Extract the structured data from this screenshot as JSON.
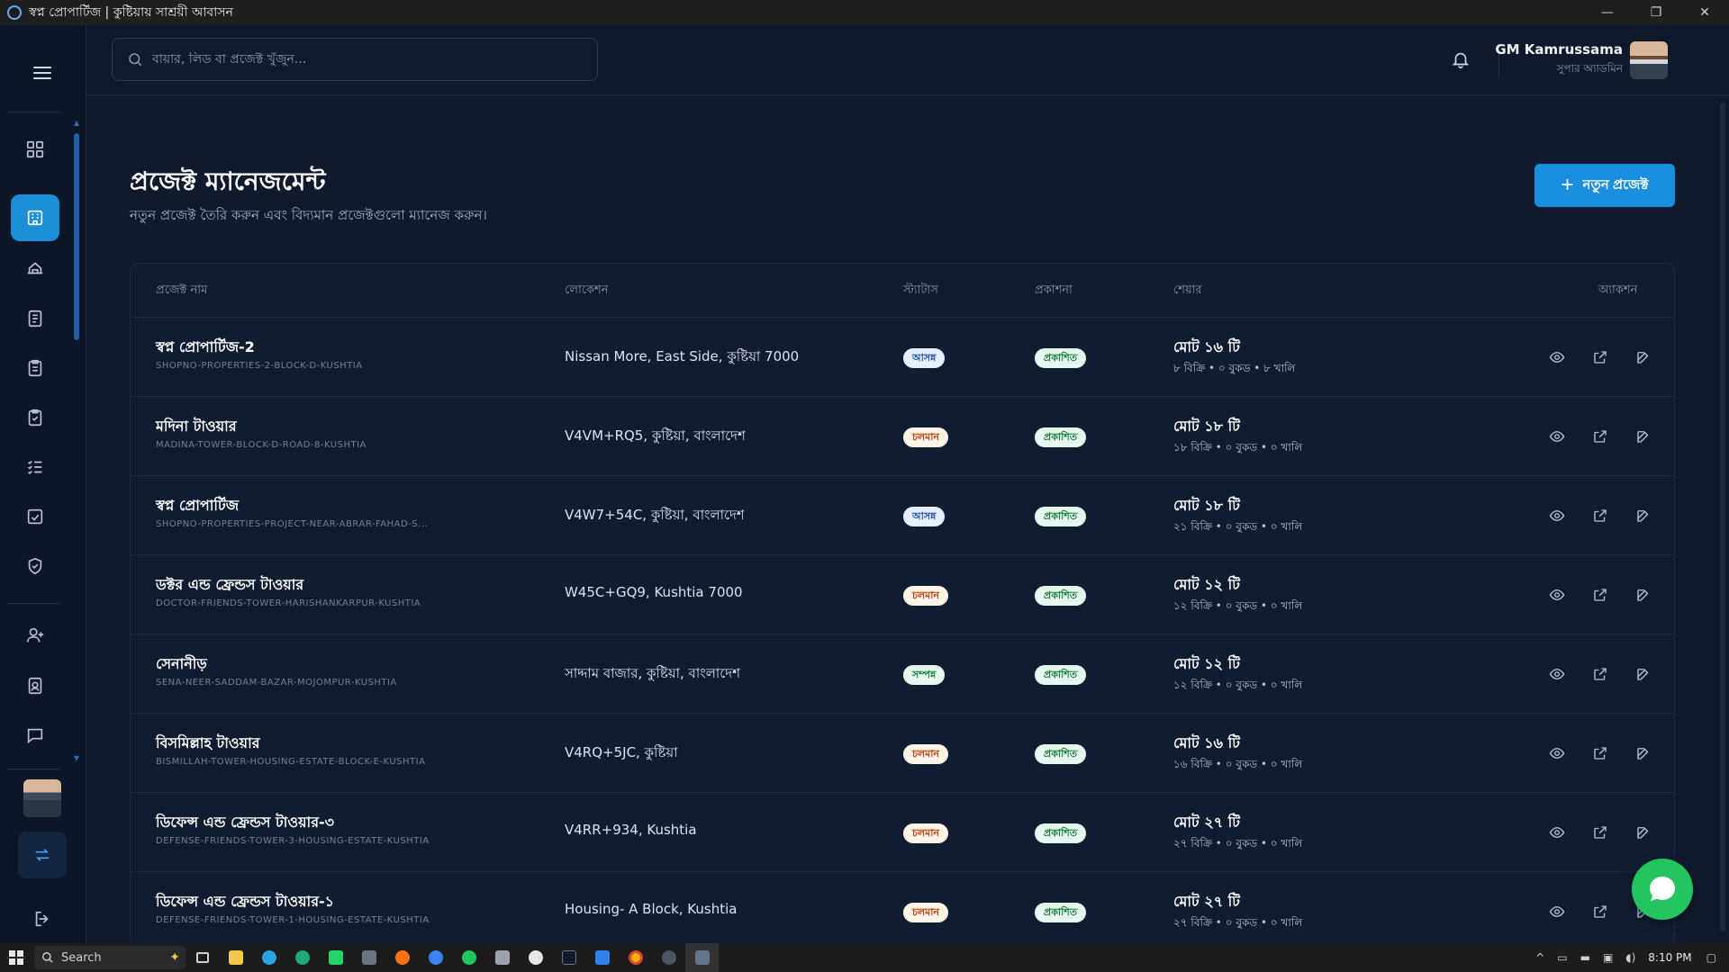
{
  "window": {
    "title": "স্বপ্ন প্রোপার্টিজ | কুষ্টিয়ায় সাশ্রয়ী আবাসন",
    "minimize": "—",
    "maximize": "❐",
    "close": "✕"
  },
  "header": {
    "search_placeholder": "বায়ার, লিড বা প্রজেক্ট খুঁজুন...",
    "user_name": "GM Kamrussama",
    "user_role": "সুপার অ্যাডমিন"
  },
  "page": {
    "title": "প্রজেক্ট ম্যানেজমেন্ট",
    "subtitle": "নতুন প্রজেক্ট তৈরি করুন এবং বিদ্যমান প্রজেক্টগুলো ম্যানেজ করুন।",
    "new_button_label": "নতুন প্রজেক্ট",
    "new_button_icon": "+"
  },
  "table": {
    "columns": {
      "name": "প্রজেক্ট নাম",
      "location": "লোকেশন",
      "status": "স্ট্যাটাস",
      "publish": "প্রকাশনা",
      "share": "শেয়ার",
      "actions": "অ্যাকশন"
    },
    "rows": [
      {
        "name": "স্বপ্ন প্রোপার্টিজ-2",
        "slug": "SHOPNO-PROPERTIES-2-BLOCK-D-KUSHTIA",
        "location": "Nissan More, East Side, কুষ্টিয়া 7000",
        "status": "আসন্ন",
        "status_type": "upcoming",
        "publish": "প্রকাশিত",
        "share_total": "মোট ১৬ টি",
        "share_detail": "৮ বিক্রি • ০ বুকড • ৮ খালি"
      },
      {
        "name": "মদিনা টাওয়ার",
        "slug": "MADINA-TOWER-BLOCK-D-ROAD-8-KUSHTIA",
        "location": "V4VM+RQ5, কুষ্টিয়া, বাংলাদেশ",
        "status": "চলমান",
        "status_type": "ongoing",
        "publish": "প্রকাশিত",
        "share_total": "মোট ১৮ টি",
        "share_detail": "১৮ বিক্রি • ০ বুকড • ০ খালি"
      },
      {
        "name": "স্বপ্ন প্রোপার্টিজ",
        "slug": "SHOPNO-PROPERTIES-PROJECT-NEAR-ABRAR-FAHAD-S...",
        "location": "V4W7+54C, কুষ্টিয়া, বাংলাদেশ",
        "status": "আসন্ন",
        "status_type": "upcoming",
        "publish": "প্রকাশিত",
        "share_total": "মোট ১৮ টি",
        "share_detail": "২১ বিক্রি • ০ বুকড • ০ খালি"
      },
      {
        "name": "ডক্টর এন্ড ফ্রেন্ডস টাওয়ার",
        "slug": "DOCTOR-FRIENDS-TOWER-HARISHANKARPUR-KUSHTIA",
        "location": "W45C+GQ9, Kushtia 7000",
        "status": "চলমান",
        "status_type": "ongoing",
        "publish": "প্রকাশিত",
        "share_total": "মোট ১২ টি",
        "share_detail": "১২ বিক্রি • ০ বুকড • ০ খালি"
      },
      {
        "name": "সেনানীড়",
        "slug": "SENA-NEER-SADDAM-BAZAR-MOJOMPUR-KUSHTIA",
        "location": "সাদ্দাম বাজার, কুষ্টিয়া, বাংলাদেশ",
        "status": "সম্পন্ন",
        "status_type": "completed",
        "publish": "প্রকাশিত",
        "share_total": "মোট ১২ টি",
        "share_detail": "১২ বিক্রি • ০ বুকড • ০ খালি"
      },
      {
        "name": "বিসমিল্লাহ টাওয়ার",
        "slug": "BISMILLAH-TOWER-HOUSING-ESTATE-BLOCK-E-KUSHTIA",
        "location": "V4RQ+5JC, কুষ্টিয়া",
        "status": "চলমান",
        "status_type": "ongoing",
        "publish": "প্রকাশিত",
        "share_total": "মোট ১৬ টি",
        "share_detail": "১৬ বিক্রি • ০ বুকড • ০ খালি"
      },
      {
        "name": "ডিফেন্স এন্ড ফ্রেন্ডস টাওয়ার-৩",
        "slug": "DEFENSE-FRIENDS-TOWER-3-HOUSING-ESTATE-KUSHTIA",
        "location": "V4RR+934, Kushtia",
        "status": "চলমান",
        "status_type": "ongoing",
        "publish": "প্রকাশিত",
        "share_total": "মোট ২৭ টি",
        "share_detail": "২৭ বিক্রি • ০ বুকড • ০ খালি"
      },
      {
        "name": "ডিফেন্স এন্ড ফ্রেন্ডস টাওয়ার-১",
        "slug": "DEFENSE-FRIENDS-TOWER-1-HOUSING-ESTATE-KUSHTIA",
        "location": "Housing- A Block, Kushtia",
        "status": "চলমান",
        "status_type": "ongoing",
        "publish": "প্রকাশিত",
        "share_total": "মোট ২৭ টি",
        "share_detail": "২৭ বিক্রি • ০ বুকড • ০ খালি"
      }
    ]
  },
  "sidebar": {
    "items": [
      "dashboard-icon",
      "building-icon",
      "home-icon",
      "list-icon",
      "clipboard-icon",
      "clipboard-check-icon",
      "checklist-icon",
      "chart-check-icon",
      "shield-icon",
      "user-plus-icon",
      "id-badge-icon",
      "chat-icon"
    ],
    "active_index": 1
  },
  "taskbar": {
    "search_label": "Search",
    "clock": "8:10 PM"
  },
  "colors": {
    "accent": "#1a8fe0",
    "upcoming_bg": "#e6efff",
    "upcoming_fg": "#1e4fa8",
    "ongoing_bg": "#fff3e6",
    "ongoing_fg": "#c2410c",
    "completed_bg": "#e6f8ee",
    "completed_fg": "#15803d",
    "published_bg": "#e6f8ee",
    "published_fg": "#15803d"
  }
}
